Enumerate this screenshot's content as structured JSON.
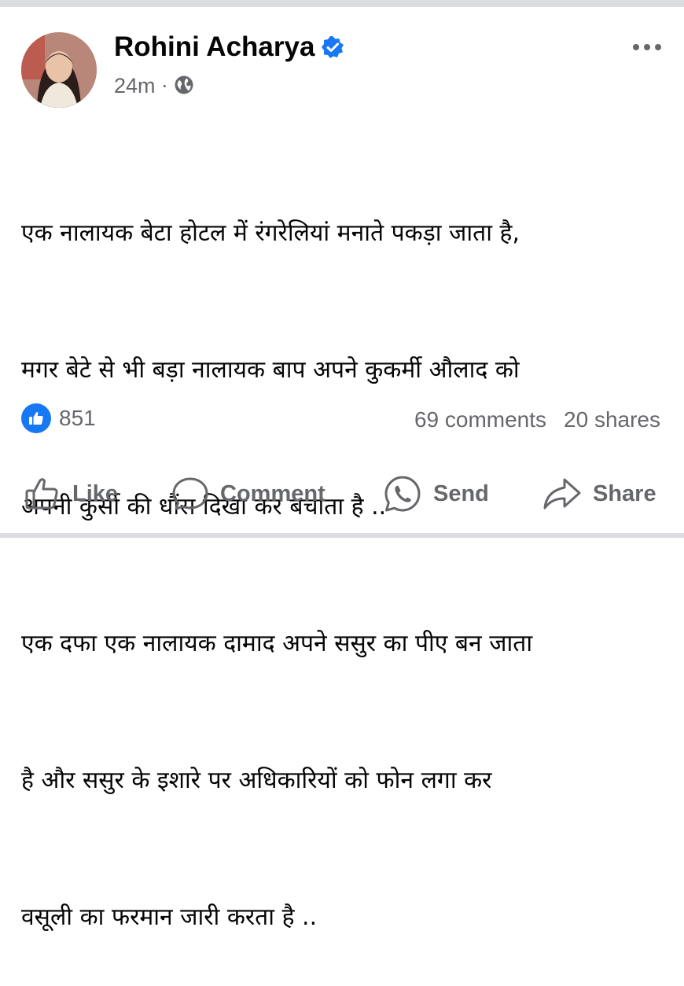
{
  "post": {
    "author": "Rohini Acharya",
    "verified": true,
    "timestamp": "24m",
    "separator": "·",
    "audience_icon": "globe-icon",
    "text_lines": [
      "एक नालायक बेटा होटल में रंगरेलियां मनाते पकड़ा जाता है,",
      "मगर बेटे से भी बड़ा नालायक बाप अपने कुकर्मी औलाद को",
      "अपनी कुर्सी की धौंस दिखा कर बचाता है ..",
      "एक दफा एक नालायक दामाद अपने ससुर का पीए बन जाता",
      "है और ससुर के इशारे पर अधिकारियों को फोन लगा कर",
      "वसूली का फरमान जारी करता है .."
    ]
  },
  "engagement": {
    "reaction_count": "851",
    "comments": "69 comments",
    "shares": "20 shares"
  },
  "actions": {
    "like": "Like",
    "comment": "Comment",
    "send": "Send",
    "share": "Share"
  },
  "colors": {
    "brand_blue": "#1877f2",
    "secondary_text": "#65676b",
    "divider": "#dcdde0"
  }
}
